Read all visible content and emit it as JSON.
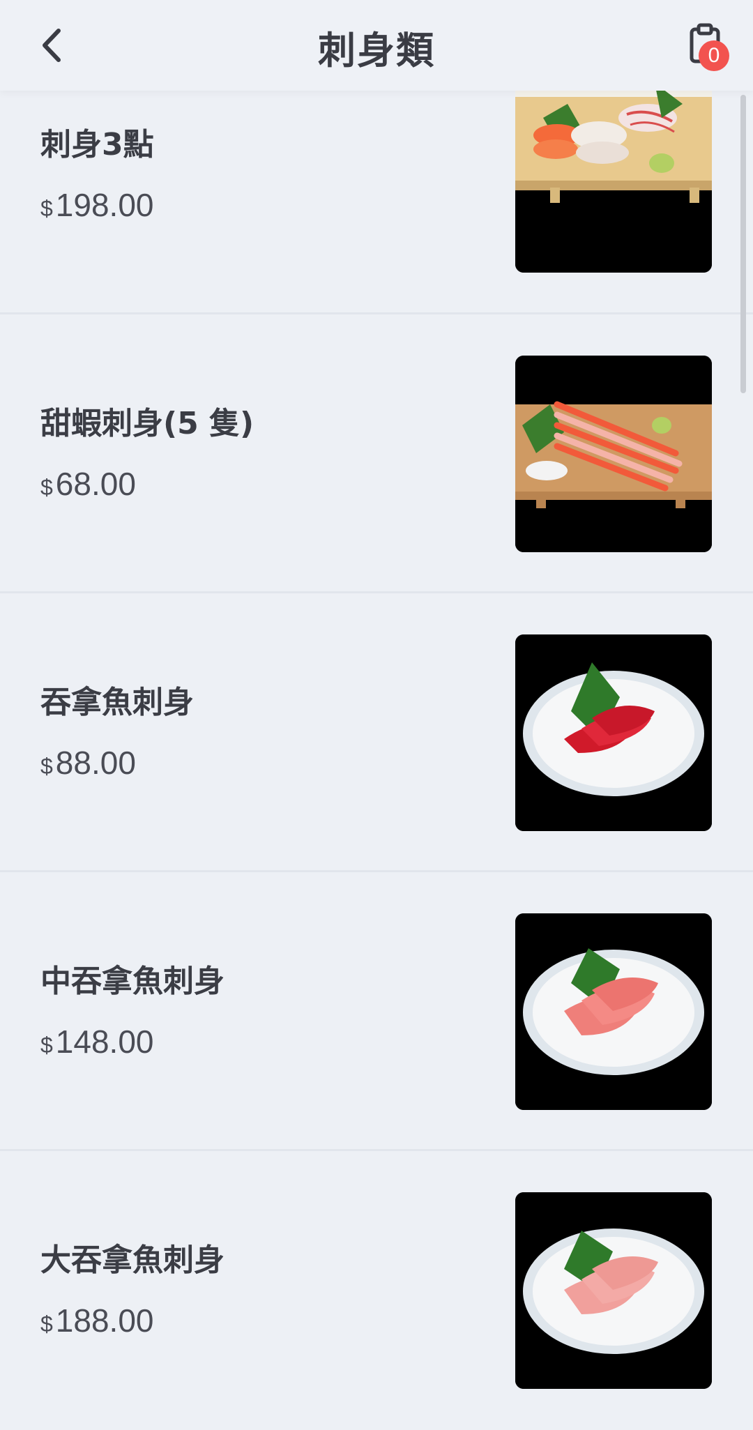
{
  "header": {
    "title": "刺身類",
    "back_icon": "chevron-left-icon",
    "cart_icon": "clipboard-cart-icon",
    "cart_count": "0",
    "badge_color": "#f2534f"
  },
  "currency_symbol": "$",
  "items": [
    {
      "name": "刺身3點",
      "price": "198.00",
      "image": "assorted-sashimi-board"
    },
    {
      "name": "甜蝦刺身(5 隻)",
      "price": "68.00",
      "image": "sweet-shrimp-board"
    },
    {
      "name": "吞拿魚刺身",
      "price": "88.00",
      "image": "tuna-sashimi-plate"
    },
    {
      "name": "中吞拿魚刺身",
      "price": "148.00",
      "image": "medium-fatty-tuna-plate"
    },
    {
      "name": "大吞拿魚刺身",
      "price": "188.00",
      "image": "fatty-tuna-plate"
    }
  ]
}
